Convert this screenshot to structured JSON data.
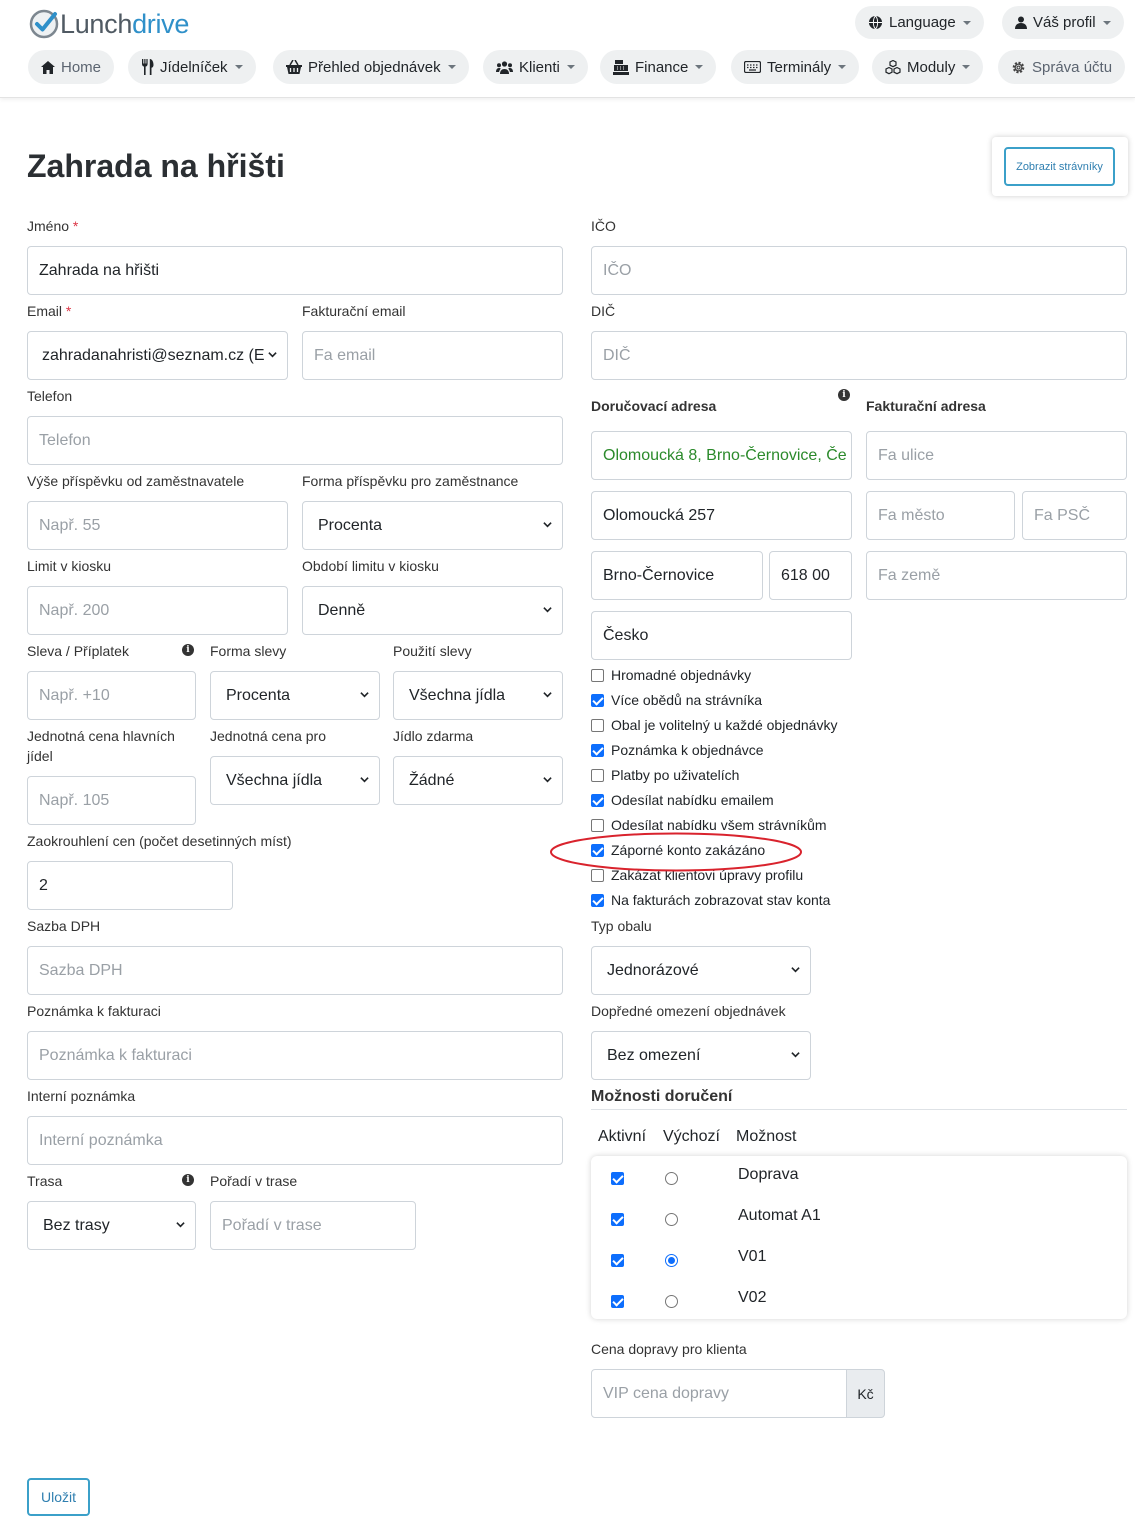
{
  "brand": {
    "name_prefix": "Lunch",
    "name_suffix": "drive"
  },
  "topbar": {
    "language": "Language",
    "profile": "Váš profil"
  },
  "nav": {
    "home": "Home",
    "menu": "Jídelníček",
    "orders": "Přehled objednávek",
    "clients": "Klienti",
    "finance": "Finance",
    "terminals": "Terminály",
    "modules": "Moduly",
    "account": "Správa účtu"
  },
  "page": {
    "title": "Zahrada na hřišti",
    "show_diners_button": "Zobrazit strávníky",
    "save_button": "Uložit"
  },
  "left": {
    "name_label": "Jméno",
    "name_value": "Zahrada na hřišti",
    "email_label": "Email",
    "email_value": "zahradanahristi@seznam.cz (E",
    "invoice_email_label": "Fakturační email",
    "invoice_email_placeholder": "Fa email",
    "phone_label": "Telefon",
    "phone_placeholder": "Telefon",
    "contribution_label": "Výše příspěvku od zaměstnavatele",
    "contribution_placeholder": "Např. 55",
    "contribution_form_label": "Forma příspěvku pro zaměstnance",
    "contribution_form_value": "Procenta",
    "kiosk_limit_label": "Limit v kiosku",
    "kiosk_limit_placeholder": "Např. 200",
    "kiosk_period_label": "Období limitu v kiosku",
    "kiosk_period_value": "Denně",
    "discount_label": "Sleva / Příplatek",
    "discount_placeholder": "Např. +10",
    "discount_form_label": "Forma slevy",
    "discount_form_value": "Procenta",
    "discount_use_label": "Použití slevy",
    "discount_use_value": "Všechna jídla",
    "unit_price_label": "Jednotná cena hlavních jídel",
    "unit_price_placeholder": "Např. 105",
    "unit_price_for_label": "Jednotná cena pro",
    "unit_price_for_value": "Všechna jídla",
    "free_meal_label": "Jídlo zdarma",
    "free_meal_value": "Žádné",
    "rounding_label": "Zaokrouhlení cen (počet desetinných míst)",
    "rounding_value": "2",
    "vat_label": "Sazba DPH",
    "vat_placeholder": "Sazba DPH",
    "invoice_note_label": "Poznámka k fakturaci",
    "invoice_note_placeholder": "Poznámka k fakturaci",
    "internal_note_label": "Interní poznámka",
    "internal_note_placeholder": "Interní poznámka",
    "route_label": "Trasa",
    "route_value": "Bez trasy",
    "route_order_label": "Pořadí v trase",
    "route_order_placeholder": "Pořadí v trase"
  },
  "right": {
    "ico_label": "IČO",
    "ico_placeholder": "IČO",
    "dic_label": "DIČ",
    "dic_placeholder": "DIČ",
    "delivery_address_label": "Doručovací adresa",
    "invoice_address_label": "Fakturační adresa",
    "delivery_full": "Olomoucká 8, Brno-Černovice, Če",
    "delivery_street": "Olomoucká 257",
    "delivery_city": "Brno-Černovice",
    "delivery_zip": "618 00",
    "delivery_country": "Česko",
    "fa_street_placeholder": "Fa ulice",
    "fa_city_placeholder": "Fa město",
    "fa_zip_placeholder": "Fa PSČ",
    "fa_country_placeholder": "Fa země",
    "checkboxes": [
      {
        "label": "Hromadné objednávky",
        "checked": false
      },
      {
        "label": "Více obědů na strávníka",
        "checked": true
      },
      {
        "label": "Obal je volitelný u každé objednávky",
        "checked": false
      },
      {
        "label": "Poznámka k objednávce",
        "checked": true
      },
      {
        "label": "Platby po uživatelích",
        "checked": false
      },
      {
        "label": "Odesílat nabídku emailem",
        "checked": true
      },
      {
        "label": "Odesílat nabídku všem strávníkům",
        "checked": false
      },
      {
        "label": "Záporné konto zakázáno",
        "checked": true
      },
      {
        "label": "Zakázat klientovi úpravy profilu",
        "checked": false
      },
      {
        "label": "Na fakturách zobrazovat stav konta",
        "checked": true
      }
    ],
    "package_type_label": "Typ obalu",
    "package_type_value": "Jednorázové",
    "order_limit_label": "Dopředné omezení objednávek",
    "order_limit_value": "Bez omezení",
    "delivery_options_title": "Možnosti doručení",
    "delivery_headers": {
      "active": "Aktivní",
      "default": "Výchozí",
      "option": "Možnost"
    },
    "delivery_options": [
      {
        "name": "Doprava",
        "active": true,
        "default": false
      },
      {
        "name": "Automat A1",
        "active": true,
        "default": false
      },
      {
        "name": "V01",
        "active": true,
        "default": true
      },
      {
        "name": "V02",
        "active": true,
        "default": false
      }
    ],
    "transport_price_label": "Cena dopravy pro klienta",
    "transport_price_placeholder": "VIP cena dopravy",
    "currency": "Kč"
  },
  "colors": {
    "accent": "#2f90c9",
    "checkbox": "#0d6efd",
    "highlight_ellipse": "#d9232d",
    "address_green": "#2b8a2b"
  }
}
